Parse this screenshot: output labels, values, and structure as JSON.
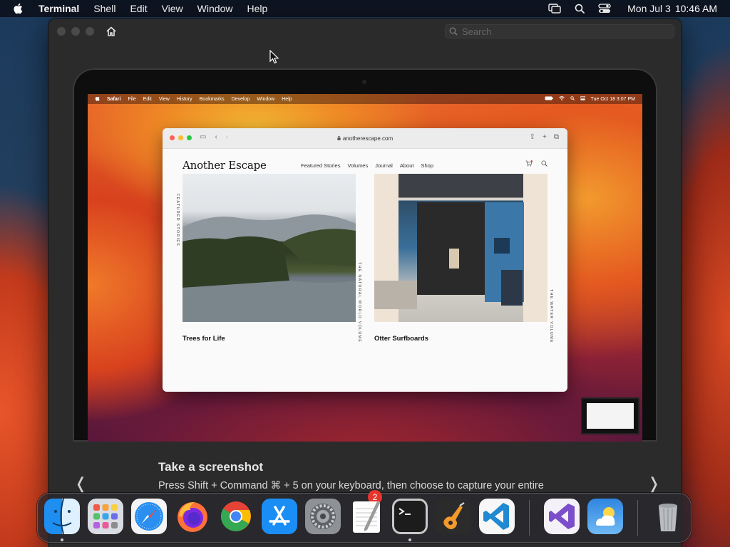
{
  "menubar": {
    "app_name": "Terminal",
    "items": [
      "Shell",
      "Edit",
      "View",
      "Window",
      "Help"
    ],
    "clock_date": "Mon Jul 3",
    "clock_time": "10:46 AM",
    "status_icons": [
      "screen-mirroring-icon",
      "spotlight-search-icon",
      "control-center-icon"
    ]
  },
  "tips_window": {
    "search_placeholder": "Search",
    "tip_title": "Take a screenshot",
    "tip_body": "Press Shift + Command ⌘ + 5 on your keyboard, then choose to capture your entire",
    "prev_label": "❬",
    "next_label": "❭"
  },
  "illustration": {
    "menubar": {
      "app_name": "Safari",
      "items": [
        "File",
        "Edit",
        "View",
        "History",
        "Bookmarks",
        "Develop",
        "Window",
        "Help"
      ],
      "clock": "Tue Oct 18  3:07 PM"
    },
    "safari": {
      "url": "anotherescape.com",
      "site_logo": "Another Escape",
      "nav": [
        "Featured Stories",
        "Volumes",
        "Journal",
        "About",
        "Shop"
      ],
      "side_label": "Featured Stories",
      "cards": [
        {
          "title": "Trees for Life",
          "volume_label": "The Natural World Volume"
        },
        {
          "title": "Otter Surfboards",
          "volume_label": "The Water Volume"
        }
      ]
    }
  },
  "dock": {
    "apps": [
      {
        "name": "Finder",
        "icon": "finder-icon",
        "running": true
      },
      {
        "name": "Launchpad",
        "icon": "launchpad-icon",
        "running": false
      },
      {
        "name": "Safari",
        "icon": "safari-icon",
        "running": false
      },
      {
        "name": "Firefox",
        "icon": "firefox-icon",
        "running": false
      },
      {
        "name": "Chrome",
        "icon": "chrome-icon",
        "running": false
      },
      {
        "name": "App Store",
        "icon": "app-store-icon",
        "running": false
      },
      {
        "name": "System Settings",
        "icon": "system-settings-icon",
        "running": false,
        "badge": "2"
      },
      {
        "name": "TextEdit",
        "icon": "textedit-icon",
        "running": false
      },
      {
        "name": "Terminal",
        "icon": "terminal-icon",
        "running": true
      },
      {
        "name": "GarageBand",
        "icon": "garageband-icon",
        "running": false
      },
      {
        "name": "Visual Studio Code",
        "icon": "vscode-icon",
        "running": false
      },
      {
        "name": "Visual Studio",
        "icon": "visual-studio-icon",
        "running": false
      },
      {
        "name": "Weather",
        "icon": "weather-icon",
        "running": false
      },
      {
        "name": "Trash",
        "icon": "trash-icon",
        "running": false
      }
    ]
  }
}
